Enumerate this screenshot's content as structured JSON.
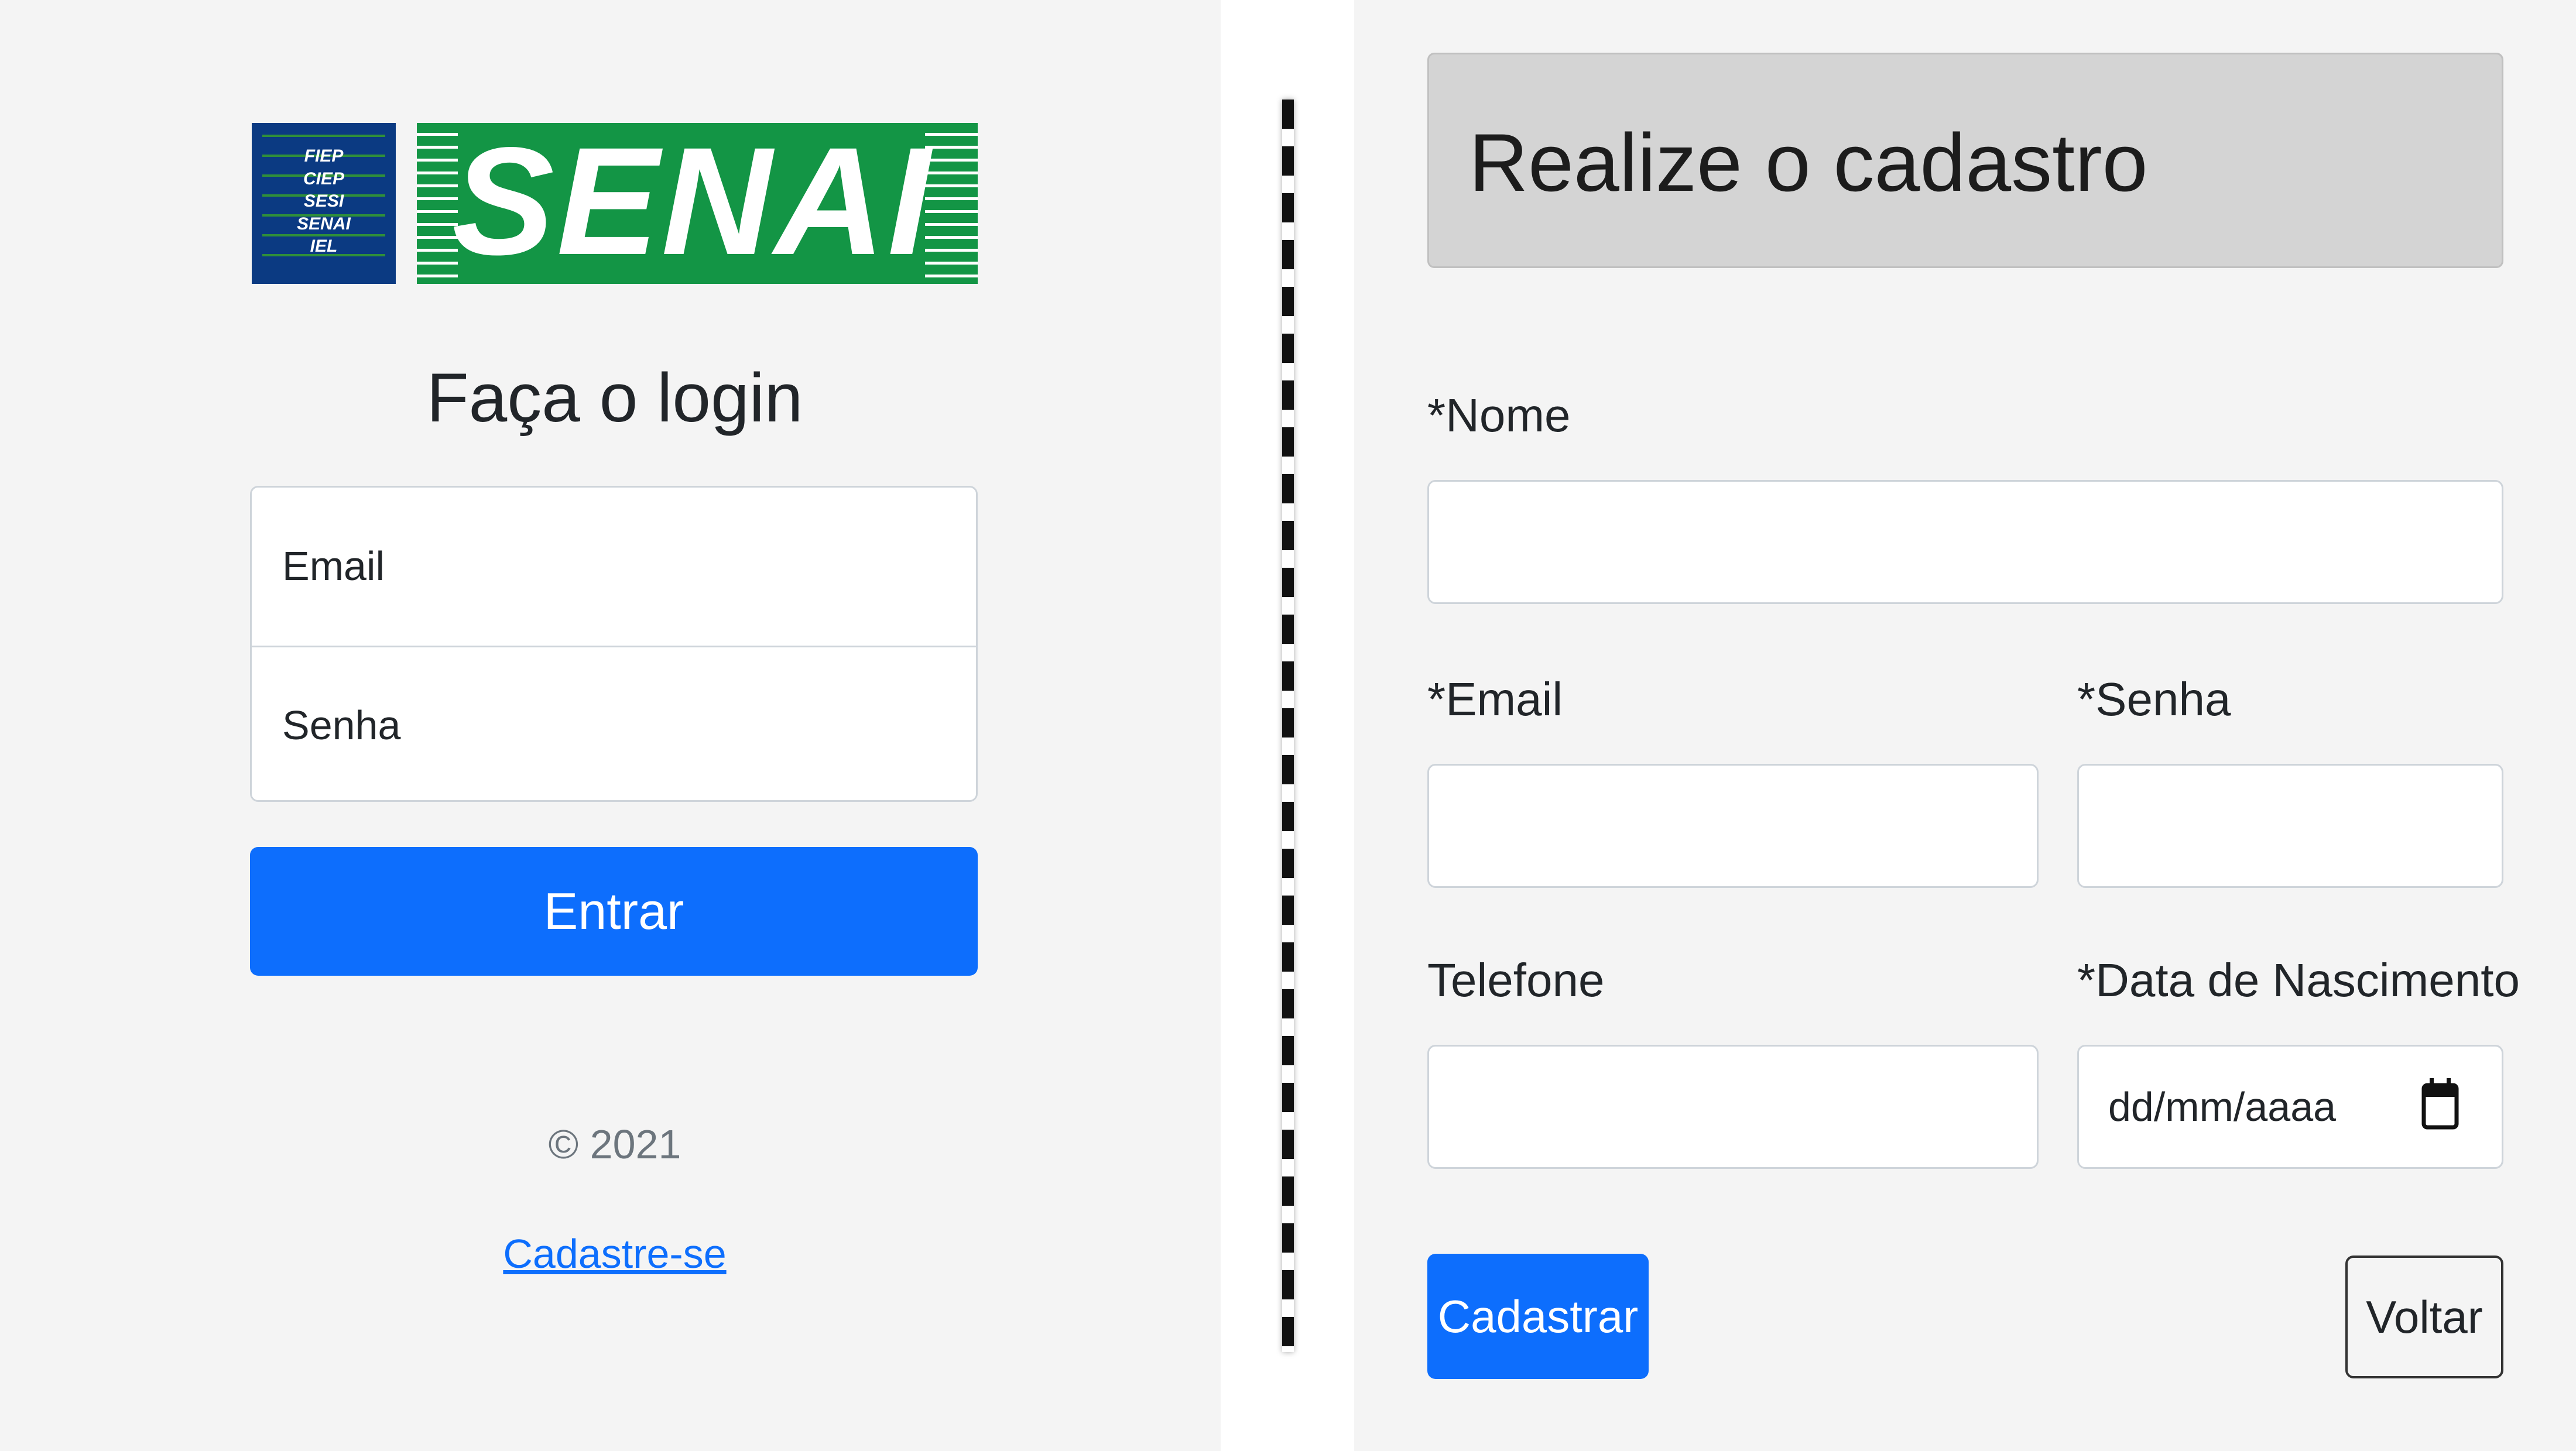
{
  "logo": {
    "orgs": [
      "FIEP",
      "CIEP",
      "SESI",
      "SENAI",
      "IEL"
    ],
    "wordmark": "SENAI",
    "colors": {
      "blue": "#0b3a82",
      "green": "#139545"
    }
  },
  "login": {
    "title": "Faça o login",
    "email_placeholder": "Email",
    "password_placeholder": "Senha",
    "submit_label": "Entrar",
    "copyright": "© 2021",
    "signup_link": "Cadastre-se"
  },
  "register": {
    "title": "Realize o cadastro",
    "name_label": "*Nome",
    "email_label": "*Email",
    "password_label": "*Senha",
    "phone_label": "Telefone",
    "birthdate_label": "*Data de Nascimento",
    "birthdate_placeholder": "dd/mm/aaaa",
    "submit_label": "Cadastrar",
    "back_label": "Voltar"
  },
  "colors": {
    "primary": "#0d6efd",
    "panel_background": "#f4f4f4",
    "header_background": "#d4d4d4"
  },
  "icons": {
    "calendar": "calendar-icon"
  }
}
